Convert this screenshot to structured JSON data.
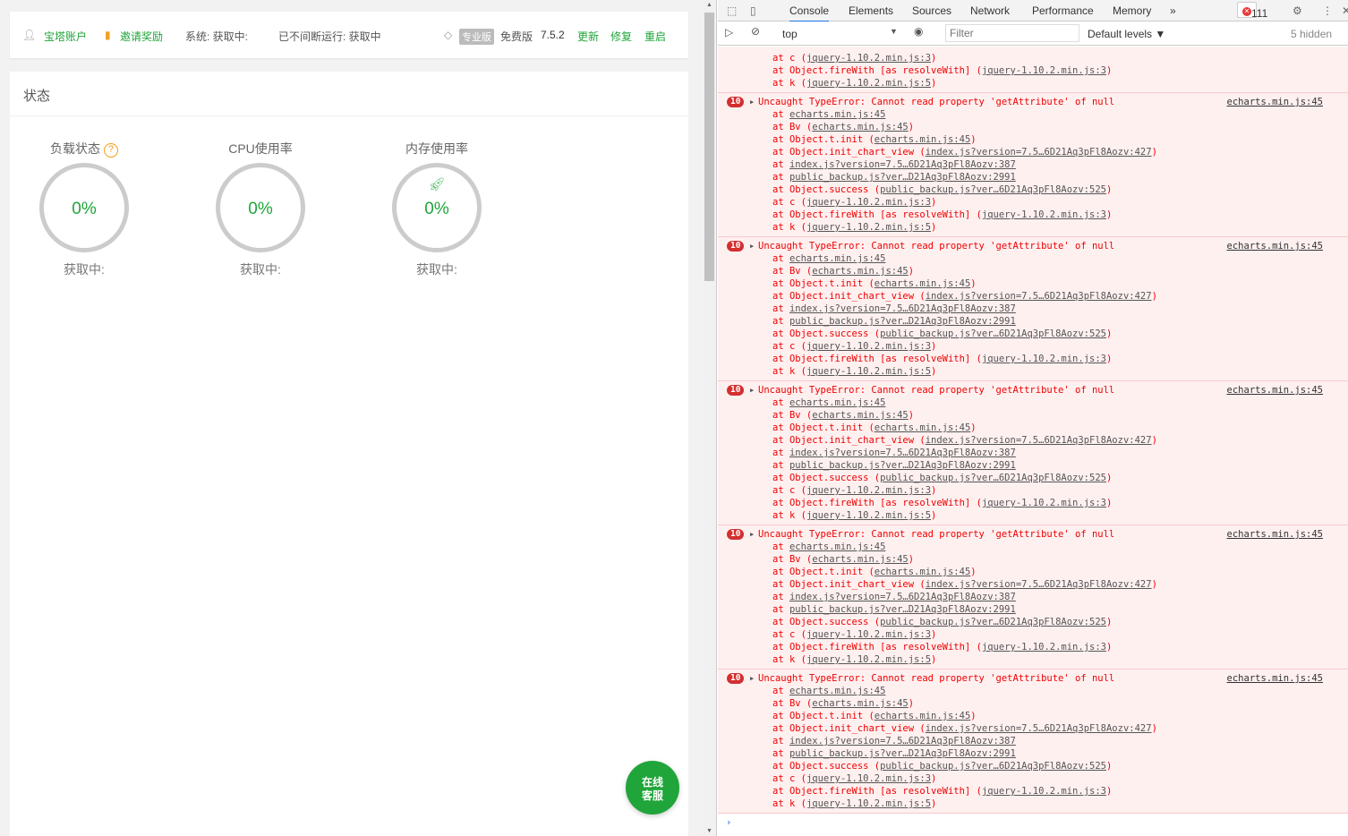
{
  "topbar": {
    "account": "宝塔账户",
    "invite": "邀请奖励",
    "system": "系统:  获取中:",
    "uptime": "已不间断运行: 获取中",
    "pro": "专业版",
    "edition": "免费版",
    "version": "7.5.2",
    "update": "更新",
    "repair": "修复",
    "restart": "重启"
  },
  "status": {
    "title": "状态",
    "gauges": [
      {
        "label": "负载状态",
        "value": "0%",
        "sub": "获取中:"
      },
      {
        "label": "CPU使用率",
        "value": "0%",
        "sub": "获取中:"
      },
      {
        "label": "内存使用率",
        "value": "0%",
        "sub": "获取中:"
      }
    ],
    "help": "?"
  },
  "chat": {
    "line1": "在线",
    "line2": "客服"
  },
  "devtools": {
    "tabs": [
      "Console",
      "Elements",
      "Sources",
      "Network",
      "Performance",
      "Memory"
    ],
    "more": "»",
    "error_count": "111",
    "context": "top",
    "filter_placeholder": "Filter",
    "levels": "Default levels ▼",
    "hidden": "5 hidden"
  },
  "console": {
    "partial": [
      {
        "pre": "at c (",
        "link": "jquery-1.10.2.min.js:3",
        "post": ")"
      },
      {
        "pre": "at Object.fireWith [as resolveWith] (",
        "link": "jquery-1.10.2.min.js:3",
        "post": ")"
      },
      {
        "pre": "at k (",
        "link": "jquery-1.10.2.min.js:5",
        "post": ")"
      }
    ],
    "error": {
      "count": "10",
      "message": "Uncaught TypeError: Cannot read property 'getAttribute' of null",
      "source": "echarts.min.js:45"
    },
    "stack": [
      {
        "pre": "at ",
        "link": "echarts.min.js:45",
        "post": ""
      },
      {
        "pre": "at Bv (",
        "link": "echarts.min.js:45",
        "post": ")"
      },
      {
        "pre": "at Object.t.init (",
        "link": "echarts.min.js:45",
        "post": ")"
      },
      {
        "pre": "at Object.init_chart_view (",
        "link": "index.js?version=7.5…6D21Aq3pFl8Aozv:427",
        "post": ")"
      },
      {
        "pre": "at ",
        "link": "index.js?version=7.5…6D21Aq3pFl8Aozv:387",
        "post": ""
      },
      {
        "pre": "at ",
        "link": "public_backup.js?ver…D21Aq3pFl8Aozv:2991",
        "post": ""
      },
      {
        "pre": "at Object.success (",
        "link": "public_backup.js?ver…6D21Aq3pFl8Aozv:525",
        "post": ")"
      },
      {
        "pre": "at c (",
        "link": "jquery-1.10.2.min.js:3",
        "post": ")"
      },
      {
        "pre": "at Object.fireWith [as resolveWith] (",
        "link": "jquery-1.10.2.min.js:3",
        "post": ")"
      },
      {
        "pre": "at k (",
        "link": "jquery-1.10.2.min.js:5",
        "post": ")"
      }
    ],
    "repeat": 5,
    "prompt": "›"
  }
}
